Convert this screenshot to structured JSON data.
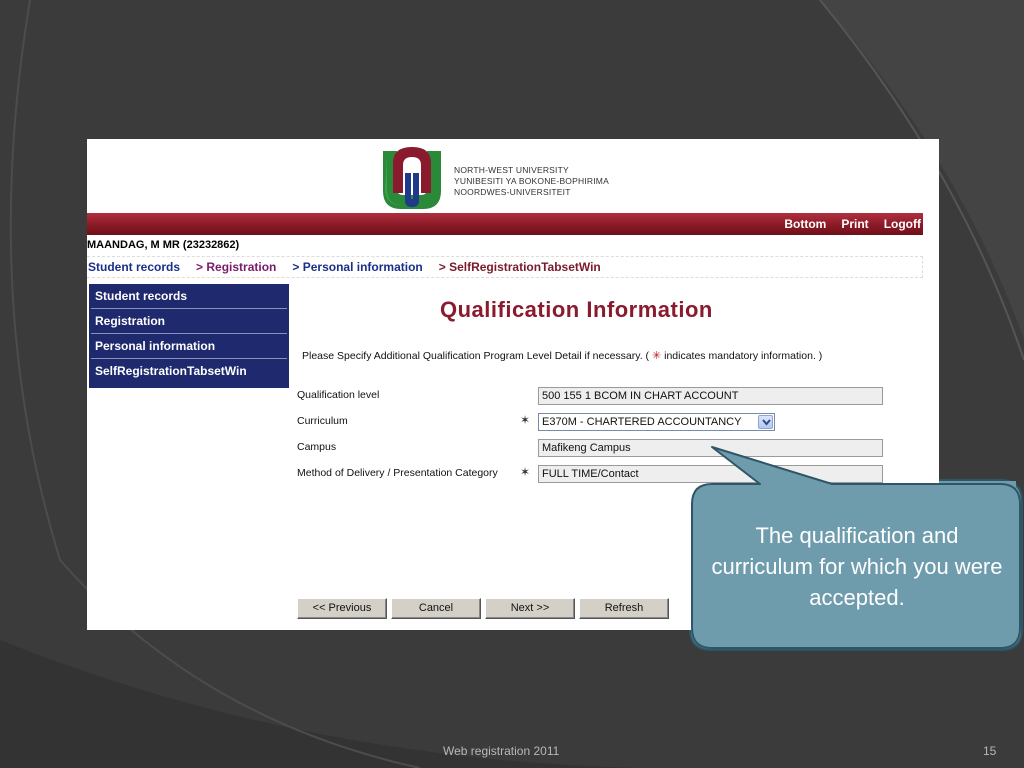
{
  "logo": {
    "lines": [
      "NORTH-WEST UNIVERSITY",
      "YUNIBESITI YA BOKONE-BOPHIRIMA",
      "NOORDWES-UNIVERSITEIT"
    ]
  },
  "topbar": {
    "links": [
      "Bottom",
      "Print",
      "Logoff"
    ]
  },
  "student": "MAANDAG, M MR (23232862)",
  "breadcrumb": [
    "Student records",
    "> Registration",
    "> Personal information",
    "> SelfRegistrationTabsetWin"
  ],
  "sidemenu": [
    "Student records",
    "Registration",
    "Personal information",
    "SelfRegistrationTabsetWin"
  ],
  "main": {
    "title": "Qualification Information",
    "instruction_before": "Please Specify Additional Qualification Program Level Detail if necessary. ( ",
    "instruction_star": "✳",
    "instruction_after": " indicates mandatory information. )"
  },
  "form": {
    "qualification_level": {
      "label": "Qualification level",
      "value": "500 155 1 BCOM IN CHART ACCOUNT"
    },
    "curriculum": {
      "label": "Curriculum",
      "value": "E370M - CHARTERED ACCOUNTANCY"
    },
    "campus": {
      "label": "Campus",
      "value": "Mafikeng Campus"
    },
    "delivery": {
      "label": "Method of Delivery / Presentation Category",
      "value": "FULL TIME/Contact"
    },
    "required_marker": "✶"
  },
  "buttons": [
    "<< Previous",
    "Cancel",
    "Next >>",
    "Refresh"
  ],
  "callout": {
    "text": "The qualification and curriculum for which you were accepted."
  },
  "footer": {
    "title": "Web registration 2011",
    "page": "15"
  },
  "colors": {
    "slide_bg": "#3a3a3a",
    "accent_bar": "#8a1a26",
    "menu_bg": "#1f2a6e",
    "title": "#8a1a2e",
    "callout": "#6f9cad"
  }
}
